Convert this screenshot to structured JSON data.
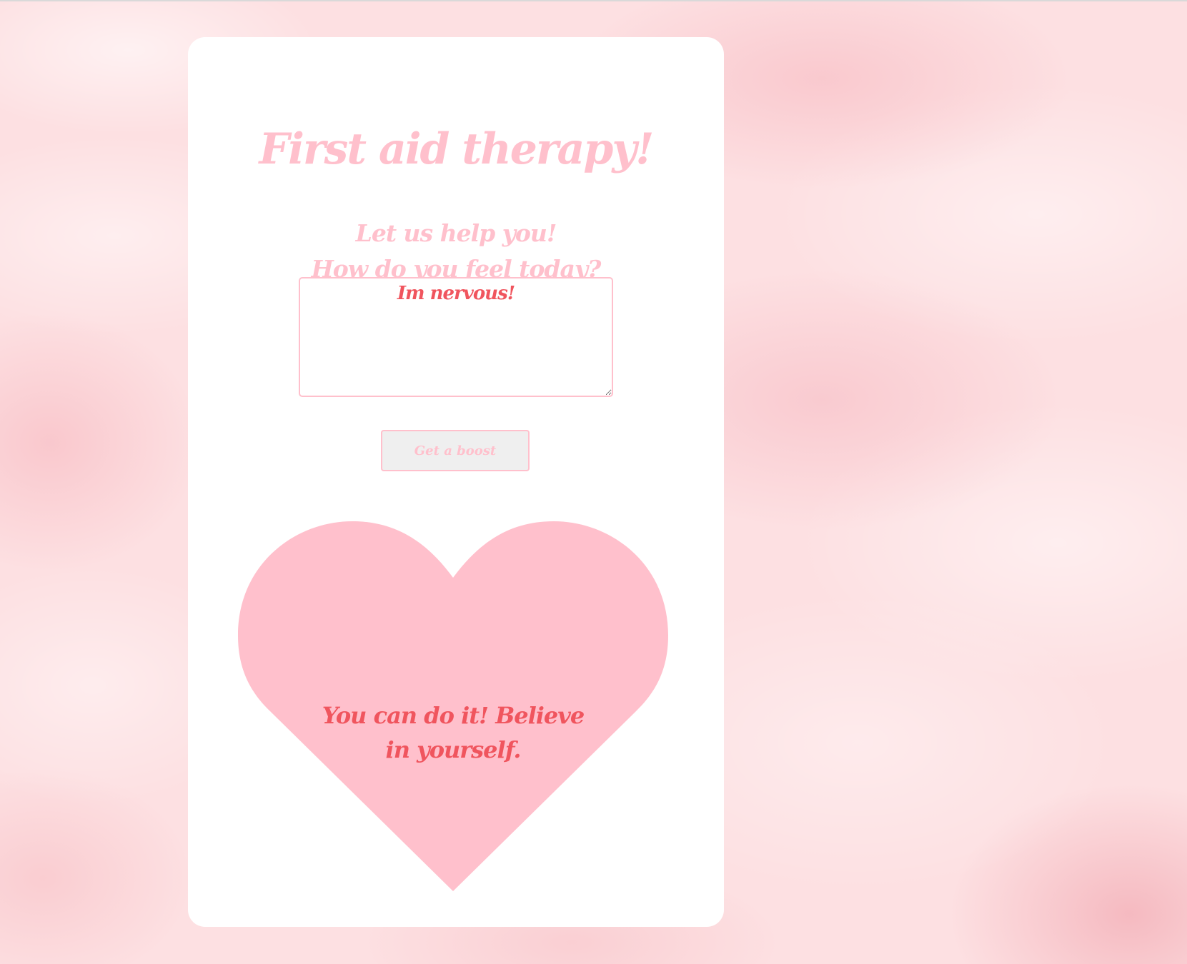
{
  "app": {
    "title": "First aid therapy!",
    "subtitle_lines": [
      "Let us help you!",
      "How do you feel today?"
    ]
  },
  "form": {
    "feeling_value": "Im nervous!",
    "boost_button_label": "Get a boost"
  },
  "result": {
    "message": "You can do it! Believe in yourself."
  },
  "colors": {
    "title_pink": "#ffc0cc",
    "heart_pink": "#ffc0cc",
    "text_red": "#f0555e",
    "card_background": "#ffffff",
    "page_background": "#fde0e2"
  },
  "icons": {
    "heart": "heart-icon",
    "resize_handle": "resize-grip-icon"
  }
}
